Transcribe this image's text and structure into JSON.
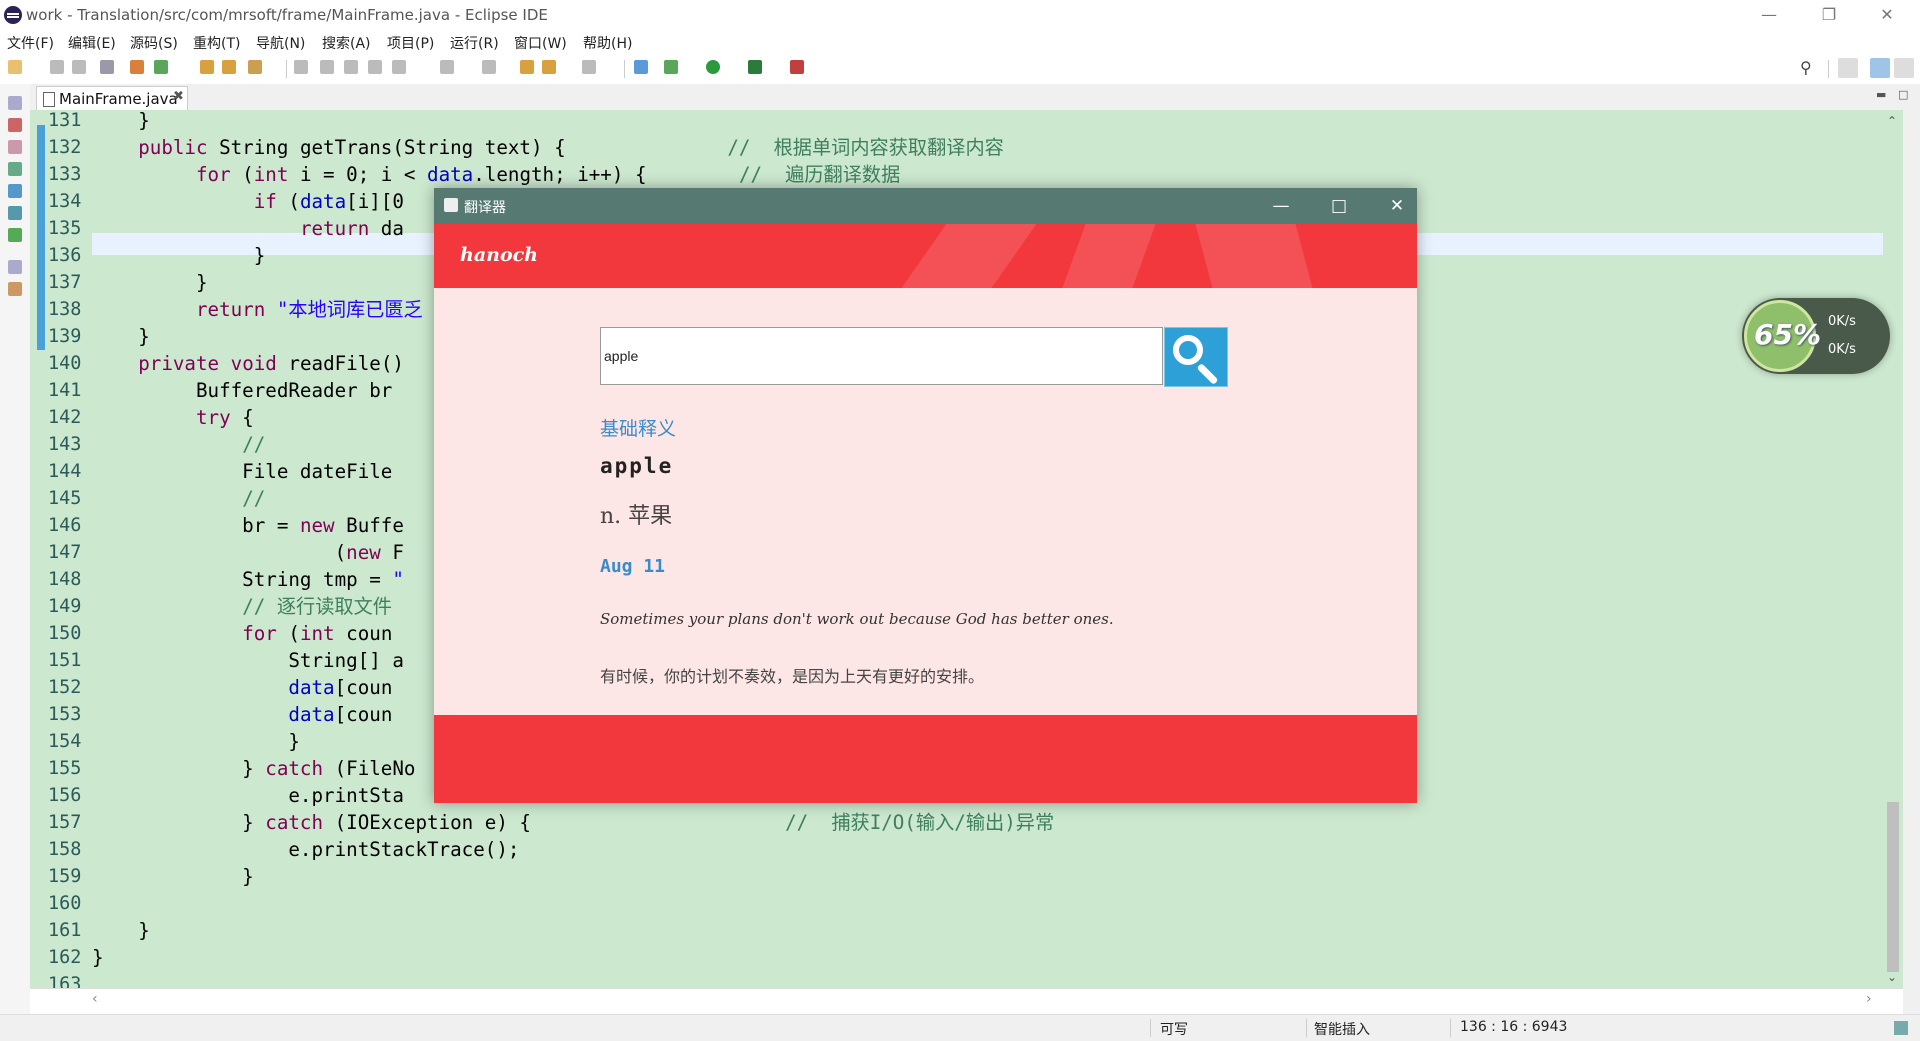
{
  "window": {
    "title": "work - Translation/src/com/mrsoft/frame/MainFrame.java - Eclipse IDE"
  },
  "menu": [
    "文件(F)",
    "编辑(E)",
    "源码(S)",
    "重构(T)",
    "导航(N)",
    "搜索(A)",
    "项目(P)",
    "运行(R)",
    "窗口(W)",
    "帮助(H)"
  ],
  "editor": {
    "tab_label": "MainFrame.java",
    "line_numbers": [
      "131",
      "132",
      "133",
      "134",
      "135",
      "136",
      "137",
      "138",
      "139",
      "140",
      "141",
      "142",
      "143",
      "144",
      "145",
      "146",
      "147",
      "148",
      "149",
      "150",
      "151",
      "152",
      "153",
      "154",
      "155",
      "156",
      "157",
      "158",
      "159",
      "160",
      "161",
      "162",
      "163"
    ],
    "code_lines": [
      "    }",
      "    public String getTrans(String text) {              //  根据单词内容获取翻译内容",
      "         for (int i = 0; i < data.length; i++) {        //  遍历翻译数据",
      "              if (data[i][0",
      "                  return da",
      "              }",
      "         }",
      "         return \"本地词库已匮乏",
      "    }",
      "    private void readFile()",
      "         BufferedReader br",
      "         try {",
      "             //",
      "             File dateFile",
      "             //",
      "             br = new Buffe",
      "                     (new F",
      "             String tmp = \"",
      "             // 逐行读取文件",
      "             for (int coun",
      "                 String[] a",
      "                 data[coun",
      "                 data[coun",
      "                 }",
      "             } catch (FileNo",
      "                 e.printSta",
      "             } catch (IOException e) {                      //  捕获I/O(输入/输出)异常",
      "                 e.printStackTrace();",
      "             }",
      "",
      "    }",
      "}",
      ""
    ]
  },
  "status": {
    "writable": "可写",
    "insert_mode": "智能插入",
    "position": "136 : 16 : 6943"
  },
  "net_widget": {
    "percent": "65%",
    "up": "0K/s",
    "down": "0K/s"
  },
  "dialog": {
    "title": "翻译器",
    "logo": "hanoch",
    "search_value": "apple",
    "section_title": "基础释义",
    "word": "apple",
    "meaning": "n. 苹果",
    "date": "Aug 11",
    "quote_en": "Sometimes your plans don't work out because God has better ones.",
    "quote_cn": "有时候，你的计划不奏效，是因为上天有更好的安排。"
  },
  "colors": {
    "editor_bg": "#cce8cf",
    "dialog_accent": "#f2383c",
    "dialog_titlebar": "#567a72",
    "link_blue": "#3a8cc8"
  }
}
